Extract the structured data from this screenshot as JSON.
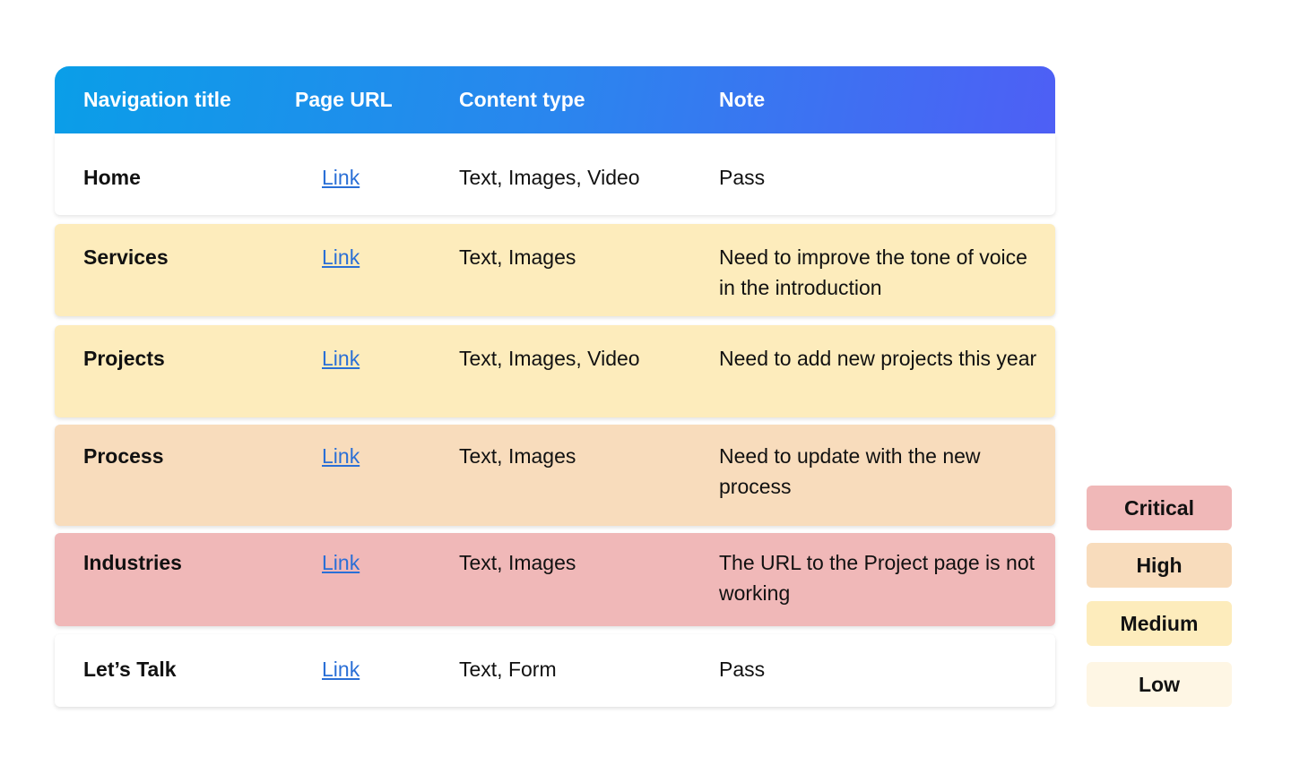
{
  "colors": {
    "critical": "#f0b8b8",
    "high": "#f8dcbc",
    "medium": "#fdecbc",
    "low": "#fef6e4",
    "pass": "#ffffff",
    "link": "#2a6fd6",
    "header_gradient_start": "#0a9ee8",
    "header_gradient_end": "#4e5ff5"
  },
  "table": {
    "headers": [
      "Navigation title",
      "Page URL",
      "Content type",
      "Note"
    ],
    "rows": [
      {
        "title": "Home",
        "url": "Link",
        "content": "Text, Images, Video",
        "note": "Pass",
        "priority": "pass"
      },
      {
        "title": "Services",
        "url": "Link",
        "content": "Text, Images",
        "note": "Need to improve the tone of voice in the introduction",
        "priority": "medium"
      },
      {
        "title": "Projects",
        "url": "Link",
        "content": "Text, Images, Video",
        "note": "Need to add new projects this year",
        "priority": "medium"
      },
      {
        "title": "Process",
        "url": "Link",
        "content": "Text, Images",
        "note": "Need to update with the new process",
        "priority": "high"
      },
      {
        "title": "Industries",
        "url": "Link",
        "content": "Text, Images",
        "note": "The URL to the Project page is not working",
        "priority": "critical"
      },
      {
        "title": "Let’s Talk",
        "url": "Link",
        "content": "Text, Form",
        "note": "Pass",
        "priority": "pass"
      }
    ]
  },
  "legend": [
    {
      "label": "Critical",
      "priority": "critical"
    },
    {
      "label": "High",
      "priority": "high"
    },
    {
      "label": "Medium",
      "priority": "medium"
    },
    {
      "label": "Low",
      "priority": "low"
    }
  ]
}
